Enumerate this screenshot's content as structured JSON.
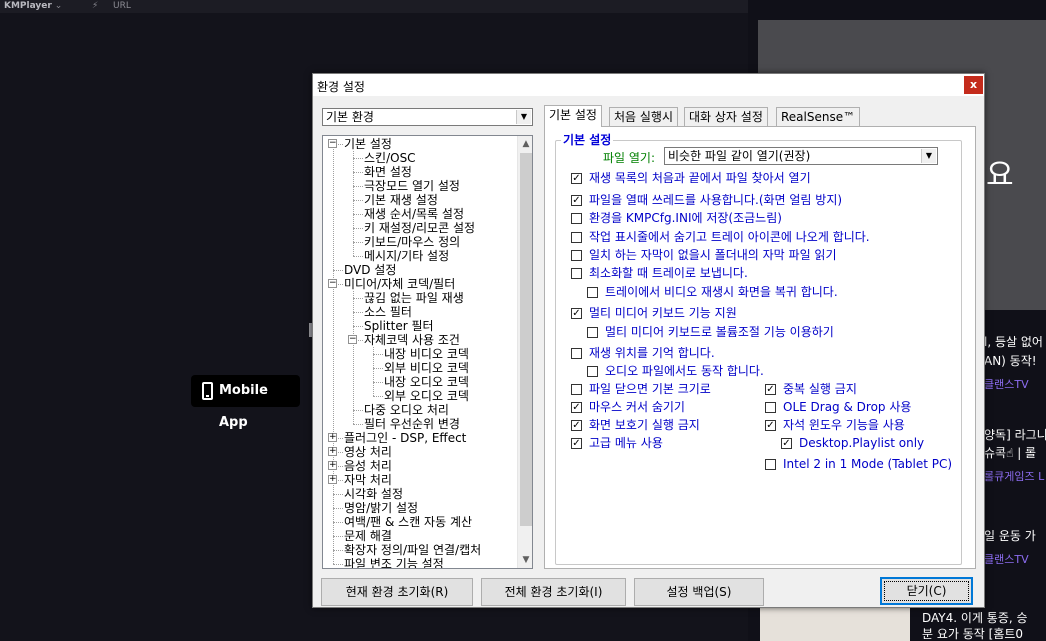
{
  "app": {
    "logo_text": "KMPlayer",
    "url_label": "URL",
    "mobile_app_label": "Mobile App"
  },
  "right_panel": {
    "big_text": "요",
    "lines": [
      {
        "text": "l, 등살 없어",
        "kind": "text"
      },
      {
        "text": "AN) 동작!",
        "kind": "text"
      },
      {
        "text": "클랜스TV",
        "kind": "sub"
      },
      {
        "text": "양독] 라그니",
        "kind": "text"
      },
      {
        "text": "슈콕☝ | 롤",
        "kind": "text"
      },
      {
        "text": "롤큐게임즈 L",
        "kind": "sub"
      },
      {
        "text": "일 운동 가",
        "kind": "text"
      },
      {
        "text": "클랜스TV",
        "kind": "sub"
      },
      {
        "text": "DAY4. 이게 통증, 승",
        "kind": "text"
      },
      {
        "text": "분 요가 동작 [홈트0",
        "kind": "text"
      }
    ]
  },
  "dialog": {
    "title": "환경 설정",
    "close_label": "x",
    "category_combo": "기본 환경",
    "tree": [
      {
        "label": "기본 설정",
        "level": 0,
        "expander": "−"
      },
      {
        "label": "스킨/OSC",
        "level": 1
      },
      {
        "label": "화면 설정",
        "level": 1
      },
      {
        "label": "극장모드 열기  설정",
        "level": 1
      },
      {
        "label": "기본 재생 설정",
        "level": 1
      },
      {
        "label": "재생 순서/목록 설정",
        "level": 1
      },
      {
        "label": "키 재설정/리모콘 설정",
        "level": 1
      },
      {
        "label": "키보드/마우스 정의",
        "level": 1
      },
      {
        "label": "메시지/기타 설정",
        "level": 1
      },
      {
        "label": "DVD 설정",
        "level": 0
      },
      {
        "label": "미디어/자체 코덱/필터",
        "level": 0,
        "expander": "−"
      },
      {
        "label": "끊김 없는 파일 재생",
        "level": 1
      },
      {
        "label": "소스 필터",
        "level": 1
      },
      {
        "label": "Splitter 필터",
        "level": 1
      },
      {
        "label": "자체코덱 사용 조건",
        "level": 1,
        "expander": "−"
      },
      {
        "label": "내장 비디오 코덱",
        "level": 2
      },
      {
        "label": "외부 비디오 코덱",
        "level": 2
      },
      {
        "label": "내장 오디오 코덱",
        "level": 2
      },
      {
        "label": "외부 오디오 코덱",
        "level": 2
      },
      {
        "label": "다중 오디오 처리",
        "level": 1
      },
      {
        "label": "필터 우선순위 변경",
        "level": 1
      },
      {
        "label": "플러그인 - DSP, Effect",
        "level": 0,
        "expander": "+"
      },
      {
        "label": "영상 처리",
        "level": 0,
        "expander": "+"
      },
      {
        "label": "음성 처리",
        "level": 0,
        "expander": "+"
      },
      {
        "label": "자막 처리",
        "level": 0,
        "expander": "+"
      },
      {
        "label": "시각화 설정",
        "level": 0
      },
      {
        "label": "명암/밝기 설정",
        "level": 0
      },
      {
        "label": "여백/팬 & 스캔 자동 계산",
        "level": 0
      },
      {
        "label": "문제 해결",
        "level": 0
      },
      {
        "label": "확장자 정의/파일 연결/캡처",
        "level": 0
      },
      {
        "label": "파일 변조 기능 설정",
        "level": 0
      }
    ],
    "tabs": [
      {
        "label": "기본 설정",
        "active": true
      },
      {
        "label": "처음 실행시",
        "active": false
      },
      {
        "label": "대화 상자 설정",
        "active": false
      },
      {
        "label": "RealSense™",
        "active": false
      }
    ],
    "group_title": "기본 설정",
    "file_open_label": "파일 열기:",
    "file_open_value": "비슷한 파일 같이 열기(권장)",
    "checkboxes": [
      {
        "label": "재생 목록의 처음과 끝에서 파일 찾아서 열기",
        "checked": true
      },
      {
        "label": "파일을 열때 쓰레드를 사용합니다.(화면 얼림 방지)",
        "checked": true
      },
      {
        "label": "환경을 KMPCfg.INI에 저장(조금느림)",
        "checked": false
      },
      {
        "label": "작업 표시줄에서 숨기고 트레이 아이콘에 나오게 합니다.",
        "checked": false
      },
      {
        "label": "일치 하는 자막이 없을시 폴더내의 자막 파일 읽기",
        "checked": false
      },
      {
        "label": "최소화할 때 트레이로 보냅니다.",
        "checked": false
      },
      {
        "label": "트레이에서 비디오 재생시 화면을 복귀 합니다.",
        "checked": false
      },
      {
        "label": "멀티 미디어 키보드 기능 지원",
        "checked": true
      },
      {
        "label": "멀티 미디어 키보드로 볼륨조절 기능 이용하기",
        "checked": false
      },
      {
        "label": "재생 위치를 기억 합니다.",
        "checked": false
      },
      {
        "label": "오디오 파일에서도 동작 합니다.",
        "checked": false
      },
      {
        "label": "파일 닫으면 기본 크기로",
        "checked": false
      },
      {
        "label": "마우스 커서 숨기기",
        "checked": true
      },
      {
        "label": "화면 보호기 실행 금지",
        "checked": true
      },
      {
        "label": "고급 메뉴 사용",
        "checked": true
      },
      {
        "label": "중복 실행 금지",
        "checked": true
      },
      {
        "label": "OLE Drag & Drop 사용",
        "checked": false
      },
      {
        "label": "자석 윈도우 기능을 사용",
        "checked": true
      },
      {
        "label": "Desktop.Playlist only",
        "checked": true
      },
      {
        "label": "Intel 2 in 1 Mode (Tablet PC)",
        "checked": false
      }
    ],
    "buttons": {
      "reset_current": "현재 환경 초기화(R)",
      "reset_all": "전체 환경 초기화(I)",
      "backup": "설정 백업(S)",
      "close": "닫기(C)"
    }
  }
}
